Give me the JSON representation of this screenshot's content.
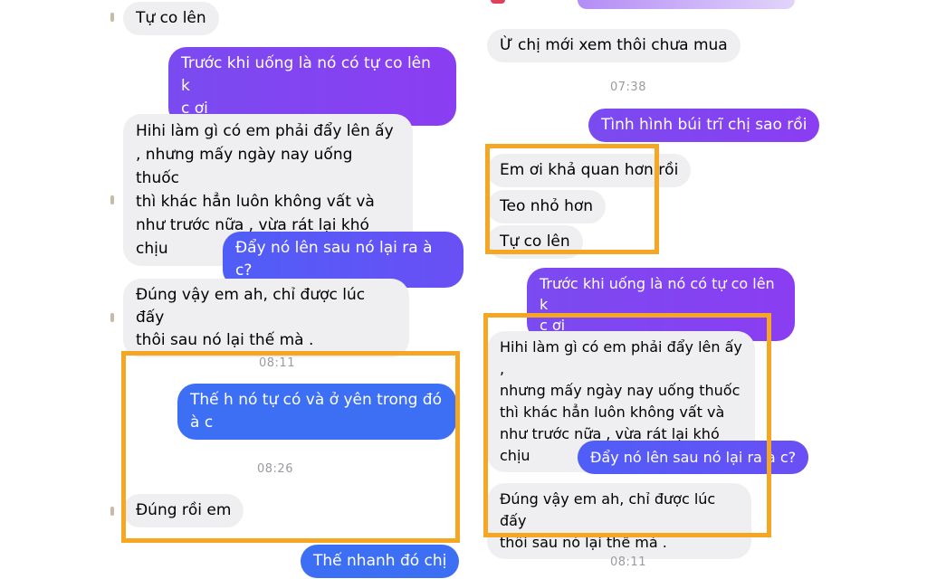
{
  "left": {
    "messages": [
      {
        "text": "Tự co lên",
        "side": "in"
      },
      {
        "text": "Trước khi uống là nó có tự co lên k\nc ơi",
        "side": "out"
      },
      {
        "text": "Hihi làm gì có em phải đẩy lên ấy\n, nhưng mấy ngày nay uống thuốc\nthì khác hẳn luôn không vất và\nnhư trước nữa , vừa rát lại khó chịu",
        "side": "in"
      },
      {
        "text": "Đẩy nó lên sau nó lại ra à c?",
        "side": "out"
      },
      {
        "text": "Đúng vậy em ah, chỉ được lúc đấy\nthôi sau nó lại thế mà .",
        "side": "in"
      },
      {
        "text": "Thế h nó tự có và ở yên trong đó\nà c",
        "side": "out"
      },
      {
        "text": "Đúng rồi em",
        "side": "in"
      },
      {
        "text": "Thế nhanh đó chị",
        "side": "out"
      }
    ],
    "timestamps": [
      "08:11",
      "08:26"
    ]
  },
  "right": {
    "messages": [
      {
        "text": "Ừ chị mới xem thôi chưa mua",
        "side": "in"
      },
      {
        "text": "Tình hình búi trĩ chị sao rồi",
        "side": "out"
      },
      {
        "text": "Em ơi khả quan hơn rồi",
        "side": "in"
      },
      {
        "text": "Teo nhỏ hơn",
        "side": "in"
      },
      {
        "text": "Tự co lên",
        "side": "in"
      },
      {
        "text": "Trước khi uống là nó có tự co lên k\nc ơi",
        "side": "out"
      },
      {
        "text": "Hihi làm gì có em phải đẩy lên ấy ,\nnhưng mấy ngày nay uống thuốc\nthì khác hẳn luôn không vất và\nnhư trước nữa , vừa rát lại khó chịu",
        "side": "in"
      },
      {
        "text": "Đẩy nó lên sau nó lại ra à c?",
        "side": "out"
      },
      {
        "text": "Đúng vậy em ah, chỉ được lúc đấy\nthôi sau nó lại thế mà .",
        "side": "in"
      }
    ],
    "timestamps": [
      "07:38",
      "08:11"
    ]
  },
  "colors": {
    "incoming_bubble": "#efeff1",
    "outgoing_purple": "#8b3df2",
    "outgoing_blue": "#3d6ff5",
    "highlight_border": "#f5a623",
    "timestamp": "#9a9ba0"
  }
}
